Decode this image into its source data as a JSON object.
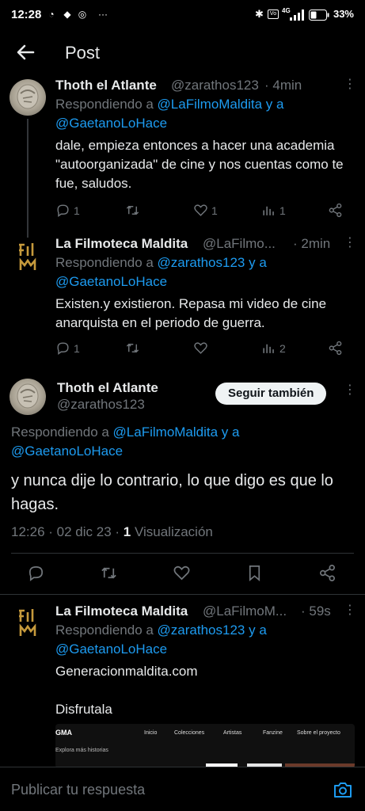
{
  "status_bar": {
    "time": "12:28",
    "battery": "33%",
    "network": "4G"
  },
  "header": {
    "title": "Post"
  },
  "tweet1": {
    "name": "Thoth el Atlante",
    "handle": "@zarathos123",
    "time": "· 4min",
    "reply_prefix": "Respondiendo a ",
    "reply_users": "@LaFilmoMaldita y a @GaetanoLoHace",
    "text": "dale, empieza entonces a hacer una academia \"autoorganizada\" de cine y nos cuentas como te fue, saludos.",
    "replies": "1",
    "retweets": "",
    "likes": "1",
    "views": "1"
  },
  "tweet2": {
    "name": "La Filmoteca Maldita",
    "handle": "@LaFilmo...",
    "time": "· 2min",
    "reply_prefix": "Respondiendo a ",
    "reply_users": "@zarathos123 y a @GaetanoLoHace",
    "text": "Existen.y existieron. Repasa mi video de cine anarquista en el periodo de guerra.",
    "replies": "1",
    "retweets": "",
    "likes": "",
    "views": "2"
  },
  "main_tweet": {
    "name": "Thoth el Atlante",
    "handle": "@zarathos123",
    "follow_label": "Seguir también",
    "reply_prefix": "Respondiendo a ",
    "reply_users": "@LaFilmoMaldita y a @GaetanoLoHace",
    "text": "y nunca dije lo contrario, lo que digo es que lo hagas.",
    "timestamp": "12:26 · 02 dic 23 · ",
    "views_count": "1",
    "views_label": " Visualización"
  },
  "tweet3": {
    "name": "La Filmoteca Maldita",
    "handle": "@LaFilmoM...",
    "time": "· 59s",
    "reply_prefix": "Respondiendo a ",
    "reply_users": "@zarathos123 y a @GaetanoLoHace",
    "link": "Generacionmaldita.com",
    "text": "Disfrutala"
  },
  "preview": {
    "logo": "GMA",
    "nav": [
      "Inicio",
      "Colecciones",
      "Artistas",
      "Fanzine",
      "Sobre el proyecto"
    ],
    "subtitle": "Explora más historias"
  },
  "reply_bar": {
    "placeholder": "Publicar tu respuesta"
  },
  "colors": {
    "background": "#000000",
    "accent": "#1d9bf0",
    "muted": "#71767b",
    "text": "#e7e9ea"
  }
}
